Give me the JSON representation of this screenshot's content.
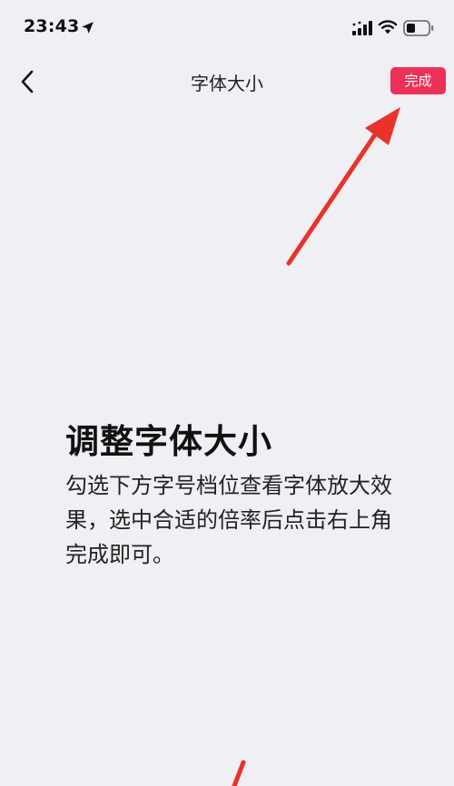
{
  "status_bar": {
    "time": "23:43"
  },
  "nav": {
    "title": "字体大小",
    "done_label": "完成"
  },
  "content": {
    "heading": "调整字体大小",
    "description": "勾选下方字号档位查看字体放大效果，选中合适的倍率后点击右上角完成即可。"
  },
  "colors": {
    "background": "#f0eff4",
    "accent": "#ec3157",
    "annotation_arrow": "#e8322a"
  },
  "icons": {
    "back": "chevron-left-icon",
    "location": "location-arrow-icon",
    "signal": "cellular-signal-icon",
    "wifi": "wifi-icon",
    "battery": "battery-icon"
  }
}
